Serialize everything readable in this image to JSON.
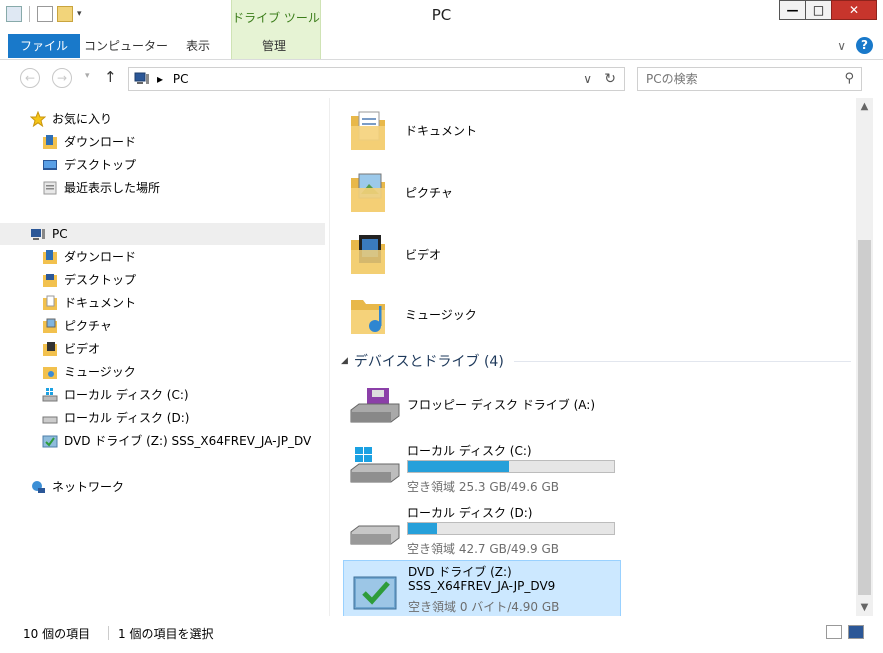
{
  "window": {
    "title": "PC",
    "context_tab": "ドライブ ツール",
    "minimize_glyph": "—",
    "maximize_glyph": "□",
    "close_glyph": "✕"
  },
  "ribbon": {
    "tabs": [
      {
        "label": "ファイル"
      },
      {
        "label": "コンピューター"
      },
      {
        "label": "表示"
      },
      {
        "label": "管理"
      }
    ],
    "expand_glyph": "∨",
    "help_glyph": "?"
  },
  "address": {
    "back_glyph": "←",
    "forward_glyph": "→",
    "recent_glyph": "▾",
    "up_glyph": "↑",
    "crumb_arrow": "▸",
    "crumb": "PC",
    "dropdown_glyph": "∨",
    "refresh_glyph": "↻",
    "search_placeholder": "PCの検索",
    "search_glyph": "⚲"
  },
  "nav": {
    "favorites": {
      "label": "お気に入り",
      "items": [
        "ダウンロード",
        "デスクトップ",
        "最近表示した場所"
      ]
    },
    "pc": {
      "label": "PC",
      "items": [
        "ダウンロード",
        "デスクトップ",
        "ドキュメント",
        "ピクチャ",
        "ビデオ",
        "ミュージック",
        "ローカル ディスク (C:)",
        "ローカル ディスク (D:)",
        "DVD ドライブ (Z:) SSS_X64FREV_JA-JP_DV"
      ]
    },
    "network": {
      "label": "ネットワーク"
    }
  },
  "folders": [
    {
      "label": "ドキュメント"
    },
    {
      "label": "ピクチャ"
    },
    {
      "label": "ビデオ"
    },
    {
      "label": "ミュージック"
    }
  ],
  "devices_group": {
    "label": "デバイスとドライブ (4)",
    "collapse_glyph": "◢"
  },
  "drives": [
    {
      "name": "フロッピー ディスク ドライブ (A:)"
    },
    {
      "name": "ローカル ディスク (C:)",
      "free": "空き領域 25.3 GB/49.6 GB",
      "used_fraction": 0.49
    },
    {
      "name": "ローカル ディスク (D:)",
      "free": "空き領域 42.7 GB/49.9 GB",
      "used_fraction": 0.14
    },
    {
      "name": "DVD ドライブ (Z:)",
      "name2": "SSS_X64FREV_JA-JP_DV9",
      "free": "空き領域 0 バイト/4.90 GB"
    }
  ],
  "scrollbar": {
    "up_glyph": "▲",
    "down_glyph": "▼"
  },
  "status": {
    "item_count": "10 個の項目",
    "selected": "1 個の項目を選択"
  },
  "colors": {
    "accent": "#1979ca",
    "selection": "#cce8ff",
    "bar_fill": "#26a0da",
    "context_tab_bg": "#e6f3d4"
  }
}
